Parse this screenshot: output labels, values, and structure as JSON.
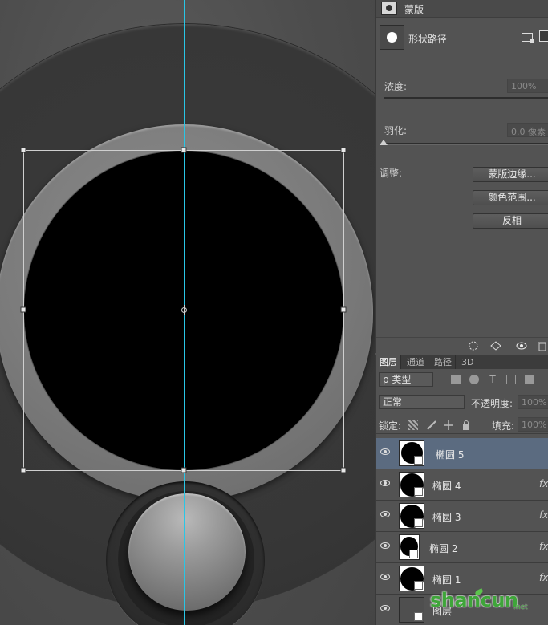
{
  "properties": {
    "header_title": "蒙版",
    "shape_label": "形状路径",
    "density_label": "浓度:",
    "density_value": "100%",
    "feather_label": "羽化:",
    "feather_value": "0.0 像素",
    "adjust_label": "调整:",
    "buttons": [
      "蒙版边缘...",
      "颜色范围...",
      "反相"
    ]
  },
  "layers_panel": {
    "tabs": [
      "图层",
      "通道",
      "路径",
      "3D"
    ],
    "filter_kind": "ρ 类型",
    "blend_mode": "正常",
    "opacity_label": "不透明度:",
    "opacity_value": "100%",
    "lock_label": "锁定:",
    "fill_label": "填充:",
    "fill_value": "100%",
    "layers": [
      {
        "name": "椭圆 5",
        "selected": true,
        "fx": ""
      },
      {
        "name": "椭圆 4",
        "selected": false,
        "fx": "fx"
      },
      {
        "name": "椭圆 3",
        "selected": false,
        "fx": "fx"
      },
      {
        "name": "椭圆 2",
        "selected": false,
        "fx": "fx"
      },
      {
        "name": "椭圆 1",
        "selected": false,
        "fx": "fx"
      },
      {
        "name": "图层",
        "selected": false,
        "fx": ""
      }
    ]
  },
  "watermark": {
    "text": "shancun",
    "sub": ".net"
  },
  "colors": {
    "guide": "#29c6e6",
    "selection": "#5b6b80",
    "watermark": "#3fa53a"
  },
  "icons": [
    "mask-icon",
    "add-mask-icon",
    "vector-mask-icon",
    "eye-icon",
    "selection-icon",
    "load-selection-icon",
    "visibility-icon",
    "trash-icon",
    "lock-pixels-icon",
    "brush-icon",
    "move-icon",
    "lock-icon"
  ]
}
